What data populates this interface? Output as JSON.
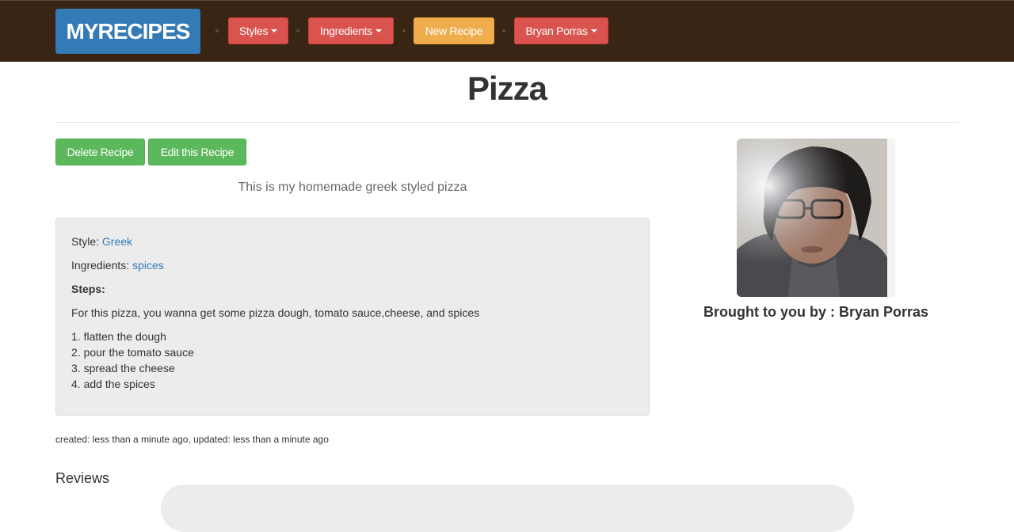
{
  "navbar": {
    "brand": "MYRECIPES",
    "items": [
      {
        "label": "Styles"
      },
      {
        "label": "Ingredients"
      },
      {
        "label": "New Recipe"
      },
      {
        "label": "Bryan Porras"
      }
    ]
  },
  "recipe": {
    "title": "Pizza",
    "summary": "This is my homemade greek styled pizza",
    "actions": {
      "delete": "Delete Recipe",
      "edit": "Edit this Recipe"
    },
    "style_label": "Style:",
    "style_value": "Greek",
    "ingredients_label": "Ingredients:",
    "ingredients_value": "spices",
    "steps_label": "Steps:",
    "description": "For this pizza, you wanna get some pizza dough, tomato sauce,cheese, and spices",
    "steps": [
      "1. flatten the dough",
      "2. pour the tomato sauce",
      "3. spread the cheese",
      "4. add the spices"
    ],
    "meta": "created: less than a minute ago, updated: less than a minute ago"
  },
  "chef": {
    "byline": "Brought to you by : Bryan Porras"
  },
  "reviews": {
    "title": "Reviews"
  },
  "colors": {
    "navbar_bg": "#382514",
    "brand": "#337ab7",
    "danger": "#d9534f",
    "warning": "#f0ad4e",
    "success": "#5cb85c",
    "link": "#337ab7"
  }
}
